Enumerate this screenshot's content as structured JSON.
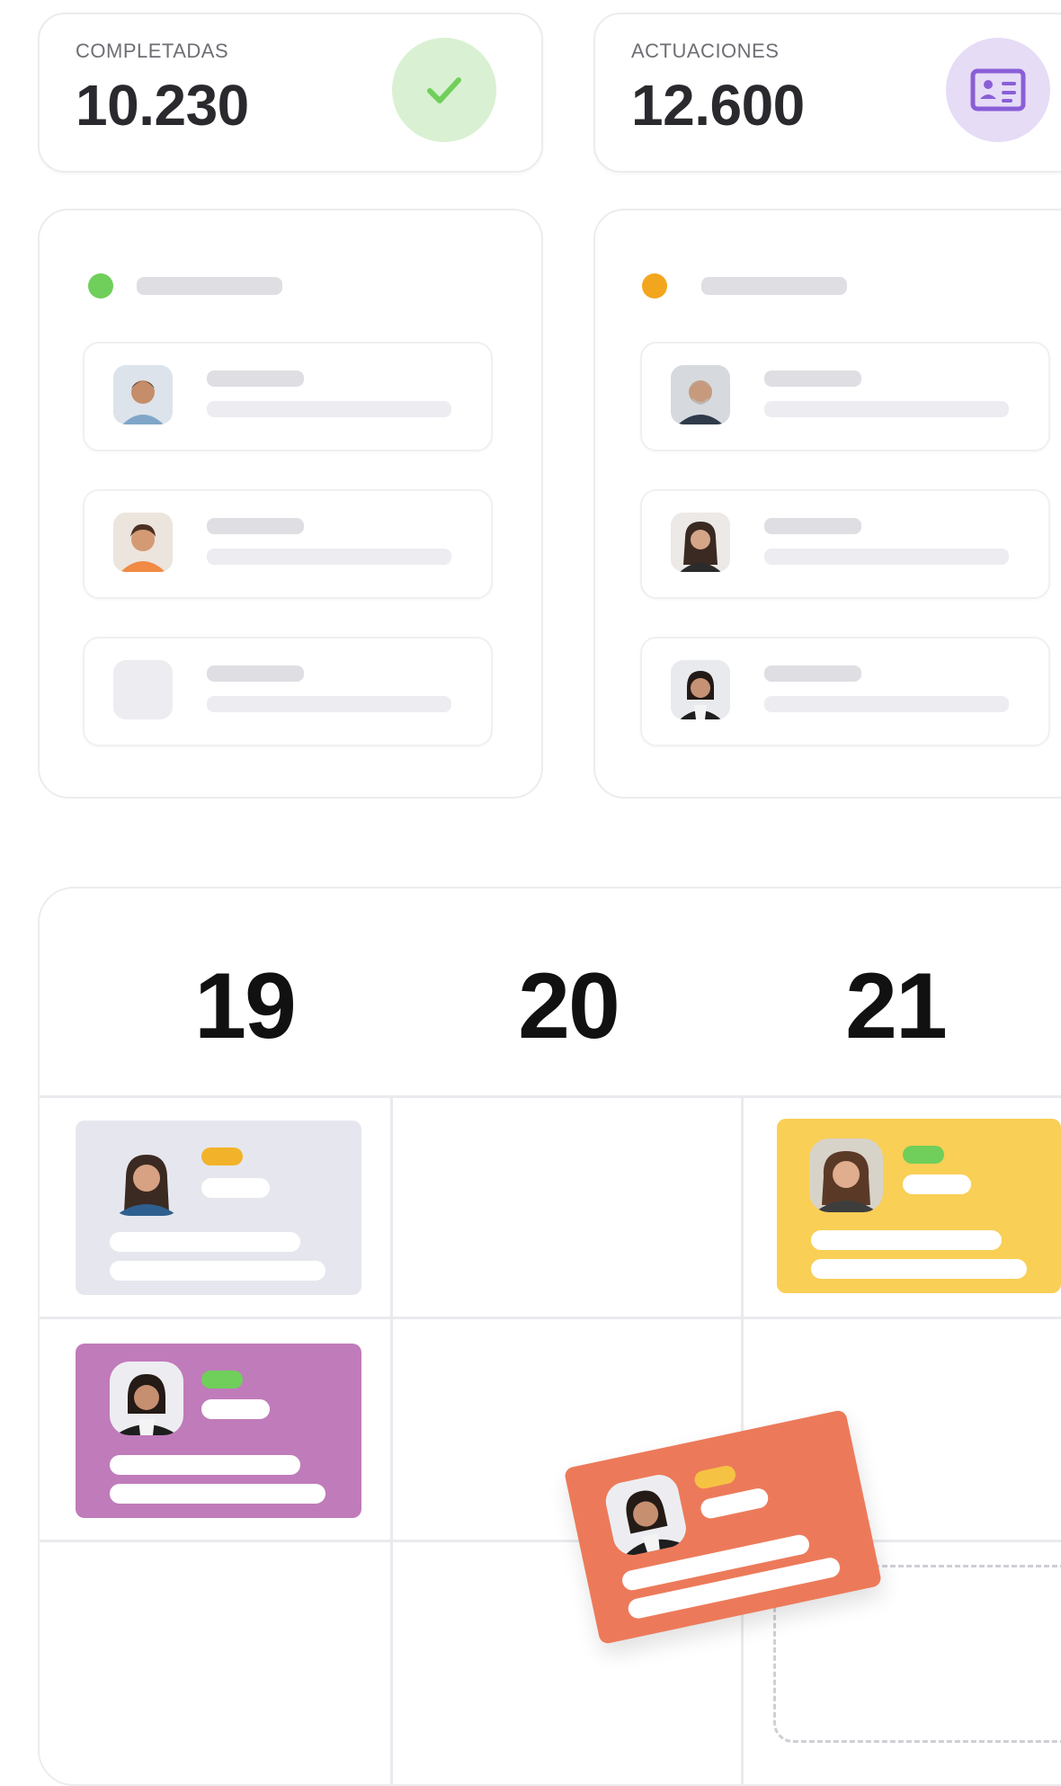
{
  "stats": [
    {
      "label": "COMPLETADAS",
      "value": "10.230",
      "icon": "checkmark-icon",
      "icon_bg": "#d9f1d2",
      "icon_color": "#6fcf5a"
    },
    {
      "label": "ACTUACIONES",
      "value": "12.600",
      "icon": "id-card-icon",
      "icon_bg": "#e6dcf6",
      "icon_color": "#8a5fd6"
    }
  ],
  "panels": [
    {
      "status_color": "#6fcf5a",
      "items": [
        "avatar-man",
        "avatar-man-orange",
        "avatar-placeholder"
      ]
    },
    {
      "status_color": "#f2a61d",
      "items": [
        "avatar-older-man",
        "avatar-woman-long-hair",
        "avatar-woman-dark"
      ]
    }
  ],
  "calendar": {
    "days": [
      "19",
      "20",
      "21"
    ],
    "events": [
      {
        "color": "#e6e7ee",
        "tag_color": "#f2b32a"
      },
      {
        "color": "#f9cf56",
        "tag_color": "#6fcf5a"
      },
      {
        "color": "#c07bba",
        "tag_color": "#6fcf5a"
      },
      {
        "color": "#ec7a5a",
        "tag_color": "#f6c244",
        "dragging": true
      }
    ]
  }
}
